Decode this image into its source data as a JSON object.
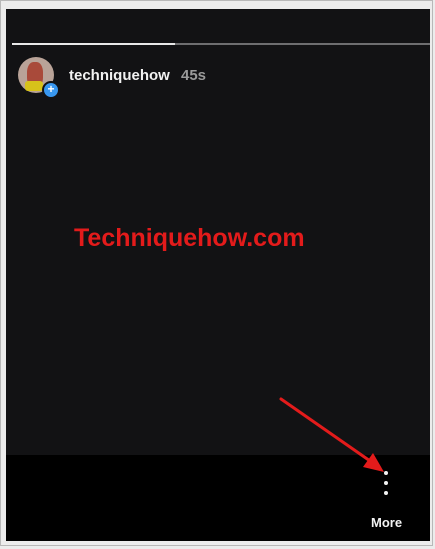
{
  "story": {
    "username": "techniquehow",
    "time_ago": "45s",
    "progress": 0.39,
    "watermark": "Techniquehow.com",
    "avatar_icon": "profile-avatar",
    "add_icon": "plus-icon"
  },
  "footer": {
    "more_icon": "vertical-ellipsis-icon",
    "more_label": "More"
  },
  "colors": {
    "background": "#000000",
    "story_bg": "#121214",
    "accent_blue": "#3897f0",
    "annotation_red": "#e31b1b"
  }
}
